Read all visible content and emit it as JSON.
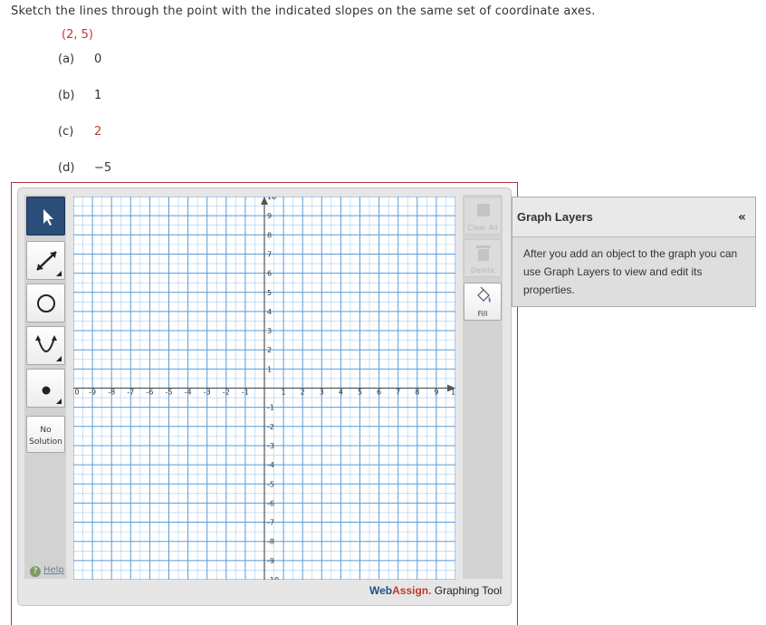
{
  "question": "Sketch the lines through the point with the indicated slopes on the same set of coordinate axes.",
  "point": "(2, 5)",
  "parts": [
    {
      "label": "(a)",
      "value": "0"
    },
    {
      "label": "(b)",
      "value": "1"
    },
    {
      "label": "(c)",
      "value": "2"
    },
    {
      "label": "(d)",
      "value": "−5"
    }
  ],
  "toolbar": {
    "tools": [
      "pointer-icon",
      "line-icon",
      "circle-icon",
      "parabola-icon",
      "point-icon"
    ],
    "no_solution": [
      "No",
      "Solution"
    ],
    "help": "Help"
  },
  "graph": {
    "x_min": -10,
    "x_max": 10,
    "y_min": -10,
    "y_max": 10,
    "x_ticks": [
      "-10",
      "-9",
      "-8",
      "-7",
      "-6",
      "-5",
      "-4",
      "-3",
      "-2",
      "-1",
      "1",
      "2",
      "3",
      "4",
      "5",
      "6",
      "7",
      "8",
      "9",
      "10"
    ],
    "y_ticks": [
      "10",
      "9",
      "8",
      "7",
      "6",
      "5",
      "4",
      "3",
      "2",
      "1",
      "-1",
      "-2",
      "-3",
      "-4",
      "-5",
      "-6",
      "-7",
      "-8",
      "-9",
      "-10"
    ],
    "grid_color": "#5a9bd5",
    "minor_grid_color": "#a9cdee"
  },
  "right_tools": {
    "clear_all": "Clear All",
    "delete": "Delete",
    "fill": "Fill"
  },
  "brand": {
    "web": "Web",
    "assign": "Assign.",
    "rest": " Graphing Tool"
  },
  "layers": {
    "title": "Graph Layers",
    "collapse": "«",
    "body": "After you add an object to the graph you can use Graph Layers to view and edit its properties."
  }
}
